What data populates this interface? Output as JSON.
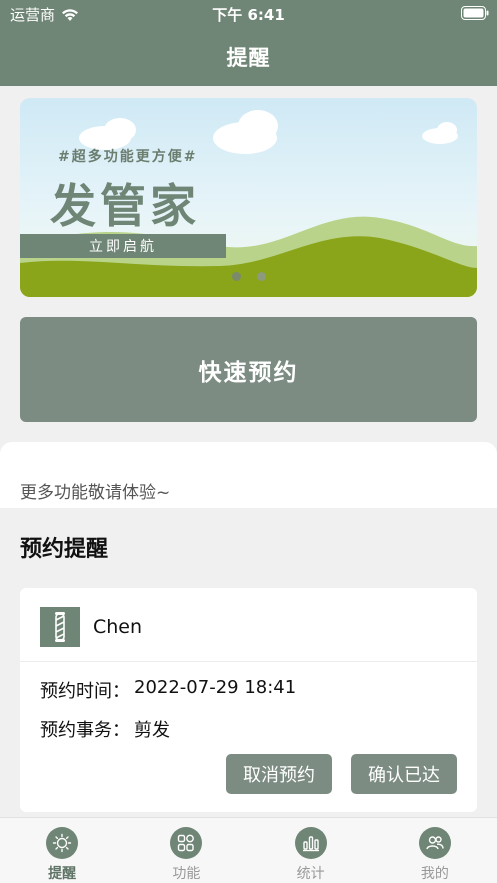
{
  "status_bar": {
    "carrier": "运营商",
    "time": "下午 6:41",
    "wifi_icon": "wifi-icon",
    "battery_icon": "battery-icon"
  },
  "nav": {
    "title": "提醒"
  },
  "banner": {
    "tagline": "#超多功能更方便#",
    "title": "发管家",
    "cta": "立即启航",
    "page_count": 2,
    "active_page": 0
  },
  "quick_booking": {
    "label": "快速预约"
  },
  "notice": {
    "text": "更多功能敬请体验~"
  },
  "reminders": {
    "section_title": "预约提醒",
    "items": [
      {
        "name": "Chen",
        "time_label": "预约时间：",
        "time_value": "2022-07-29 18:41",
        "task_label": "预约事务：",
        "task_value": "剪发",
        "cancel_label": "取消预约",
        "confirm_label": "确认已达"
      }
    ]
  },
  "tabbar": {
    "tabs": [
      {
        "label": "提醒",
        "icon": "sun-icon",
        "active": true
      },
      {
        "label": "功能",
        "icon": "grid-icon",
        "active": false
      },
      {
        "label": "统计",
        "icon": "bar-chart-icon",
        "active": false
      },
      {
        "label": "我的",
        "icon": "users-icon",
        "active": false
      }
    ]
  },
  "colors": {
    "primary": "#6f8575",
    "button": "#7c8c82",
    "background": "#f0f0f0",
    "card": "#ffffff"
  }
}
